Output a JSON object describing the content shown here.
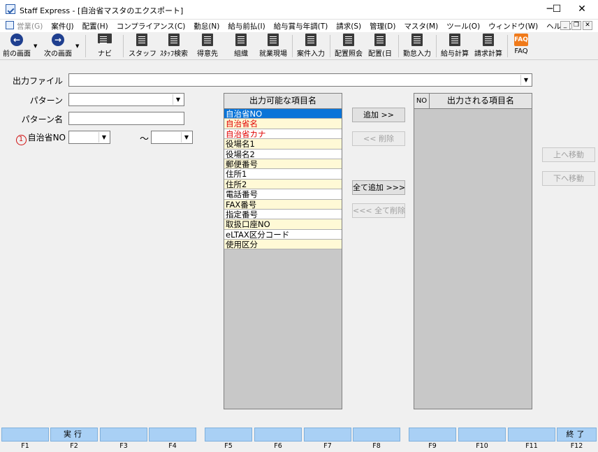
{
  "window": {
    "title": "Staff Express - [自治省マスタのエクスポート]",
    "minimize": "─",
    "maximize": "☐",
    "close": "✕"
  },
  "menubar": {
    "items": [
      {
        "label": "営業(G)",
        "disabled": true
      },
      {
        "label": "案件(J)",
        "disabled": false
      },
      {
        "label": "配置(H)",
        "disabled": false
      },
      {
        "label": "コンプライアンス(C)",
        "disabled": false
      },
      {
        "label": "勤怠(N)",
        "disabled": false
      },
      {
        "label": "給与前払(I)",
        "disabled": false
      },
      {
        "label": "給与賞与年調(T)",
        "disabled": false
      },
      {
        "label": "請求(S)",
        "disabled": false
      },
      {
        "label": "管理(D)",
        "disabled": false
      },
      {
        "label": "マスタ(M)",
        "disabled": false
      },
      {
        "label": "ツール(O)",
        "disabled": false
      },
      {
        "label": "ウィンドウ(W)",
        "disabled": false
      },
      {
        "label": "ヘルプ(H)",
        "disabled": false
      }
    ],
    "mdi_min": "_",
    "mdi_restore": "❐",
    "mdi_close": "✕"
  },
  "toolbar": {
    "prev": "前の画面",
    "next": "次の画面",
    "navi": "ナビ",
    "staff": "スタッフ",
    "staff_search": "ｽﾀｯﾌ検索",
    "client": "得意先",
    "org": "組織",
    "worksite": "就業現場",
    "case_input": "案件入力",
    "assign_query": "配置照会",
    "assign_day": "配置(日",
    "attendance_input": "勤怠入力",
    "payroll_calc": "給与計算",
    "billing_calc": "請求計算",
    "faq": "FAQ",
    "faq_icon_text": "FAQ"
  },
  "form": {
    "output_file_label": "出力ファイル",
    "output_file_value": "",
    "pattern_label": "パターン",
    "pattern_value": "",
    "pattern_name_label": "パターン名",
    "pattern_name_value": "",
    "required_mark": "1",
    "municipality_no_label": "自治省NO",
    "municipality_from": "",
    "municipality_to": "",
    "tilde": "～"
  },
  "available": {
    "header": "出力可能な項目名",
    "items": [
      {
        "label": "自治省NO",
        "style": "sel"
      },
      {
        "label": "自治省名",
        "style": "red"
      },
      {
        "label": "自治省カナ",
        "style": "red"
      },
      {
        "label": "役場名1",
        "style": ""
      },
      {
        "label": "役場名2",
        "style": ""
      },
      {
        "label": "郵便番号",
        "style": ""
      },
      {
        "label": "住所1",
        "style": ""
      },
      {
        "label": "住所2",
        "style": ""
      },
      {
        "label": "電話番号",
        "style": ""
      },
      {
        "label": "FAX番号",
        "style": ""
      },
      {
        "label": "指定番号",
        "style": ""
      },
      {
        "label": "取扱口座NO",
        "style": ""
      },
      {
        "label": "eLTAX区分コード",
        "style": ""
      },
      {
        "label": "使用区分",
        "style": ""
      }
    ]
  },
  "output": {
    "no_header": "NO",
    "name_header": "出力される項目名"
  },
  "buttons": {
    "add": "追加 >>",
    "delete": "<< 削除",
    "add_all": "全て追加 >>>",
    "delete_all": "<<< 全て削除",
    "move_up": "上へ移動",
    "move_down": "下へ移動"
  },
  "fkeys": [
    {
      "key": "F1",
      "label": ""
    },
    {
      "key": "F2",
      "label": "実行"
    },
    {
      "key": "F3",
      "label": ""
    },
    {
      "key": "F4",
      "label": ""
    },
    {
      "key": "F5",
      "label": ""
    },
    {
      "key": "F6",
      "label": ""
    },
    {
      "key": "F7",
      "label": ""
    },
    {
      "key": "F8",
      "label": ""
    },
    {
      "key": "F9",
      "label": ""
    },
    {
      "key": "F10",
      "label": ""
    },
    {
      "key": "F11",
      "label": ""
    },
    {
      "key": "F12",
      "label": "終了"
    }
  ]
}
